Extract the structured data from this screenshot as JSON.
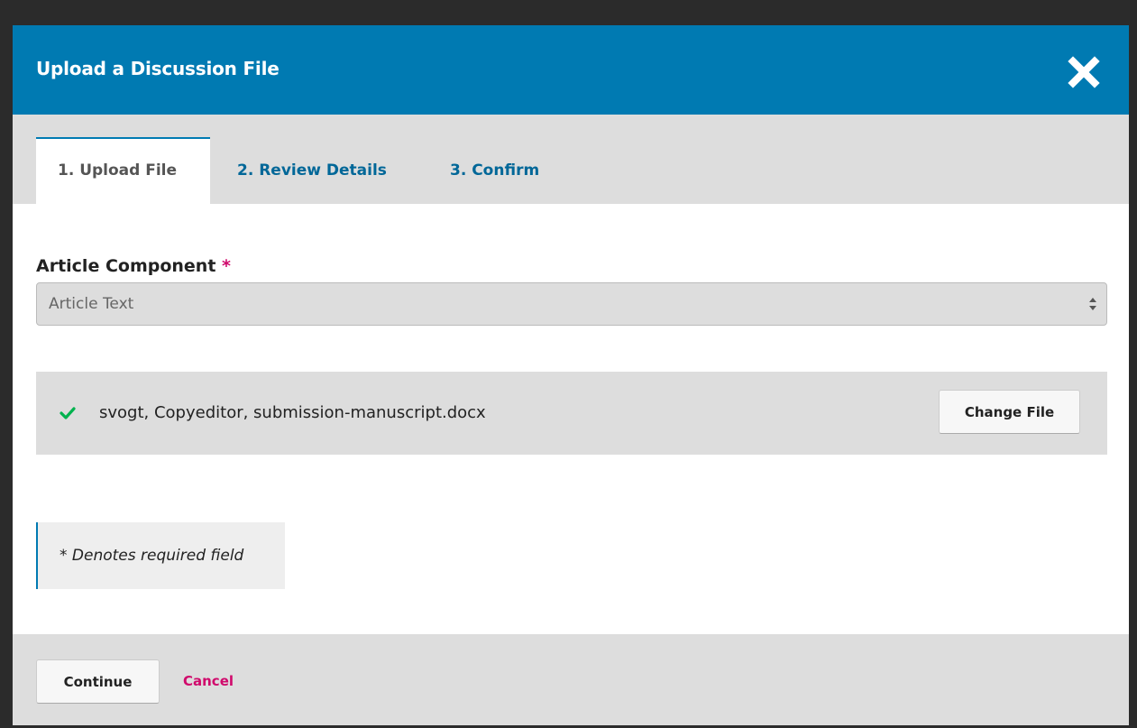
{
  "modal": {
    "title": "Upload a Discussion File",
    "close_icon": "close-x-icon"
  },
  "tabs": [
    {
      "label": "1. Upload File",
      "active": true
    },
    {
      "label": "2. Review Details",
      "active": false
    },
    {
      "label": "3. Confirm",
      "active": false
    }
  ],
  "article_component": {
    "label": "Article Component",
    "required_marker": "*",
    "selected_value": "Article Text"
  },
  "file": {
    "status_icon": "check-icon",
    "name": "svogt, Copyeditor, submission-manuscript.docx",
    "change_label": "Change File"
  },
  "required_note": "* Denotes required field",
  "footer": {
    "continue_label": "Continue",
    "cancel_label": "Cancel"
  },
  "colors": {
    "header": "#007ab2",
    "tab_link": "#006798",
    "required": "#d00a6c",
    "check": "#00b24e"
  }
}
